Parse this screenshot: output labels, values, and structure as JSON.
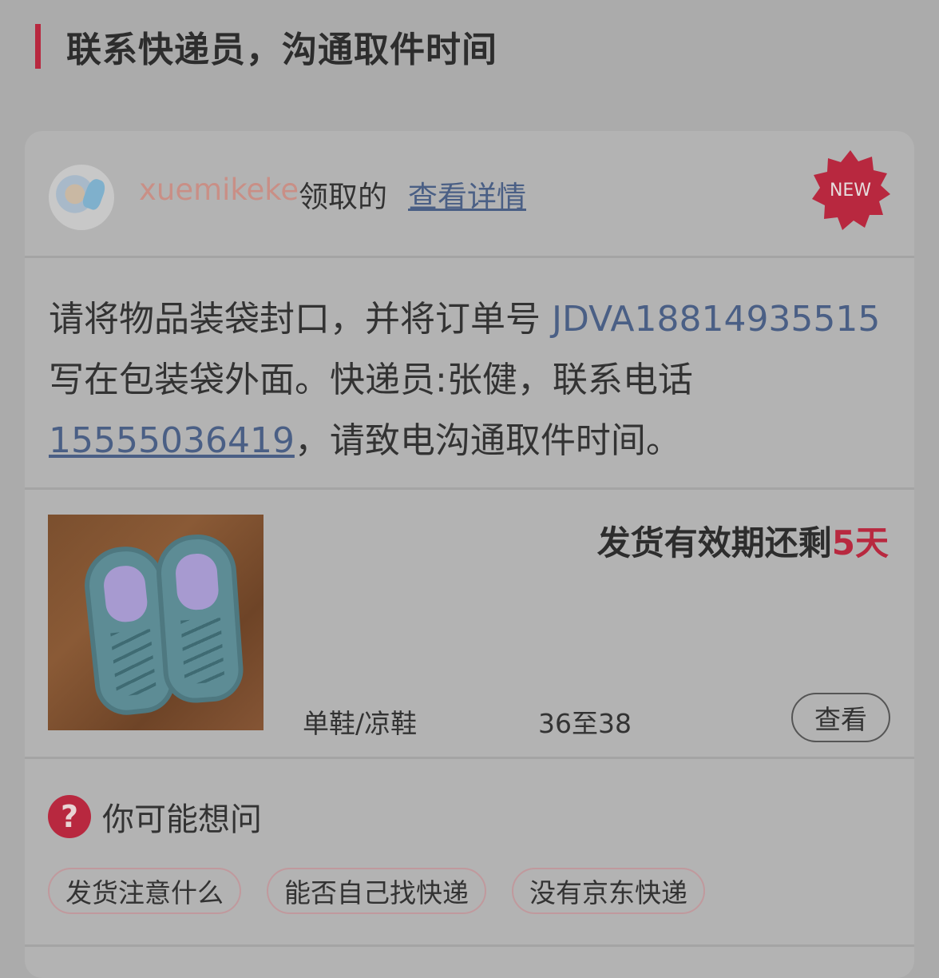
{
  "section": {
    "title": "联系快递员，沟通取件时间"
  },
  "card": {
    "user": {
      "name": "xuemikeke",
      "action": "领取的",
      "detail_link": "查看详情",
      "badge": "NEW"
    },
    "message": {
      "part1": "请将物品装袋封口，并将订单号 ",
      "order_no": "JDVA18814935515",
      "part2": " 写在包装袋外面。快递员:张健，联系电话",
      "phone": "15555036419",
      "part3": "，请致电沟通取件时间。"
    },
    "product": {
      "expire_prefix": "发货有效期还剩",
      "expire_days": "5天",
      "category": "单鞋/凉鞋",
      "size": "36至38",
      "view_label": "查看"
    },
    "faq": {
      "icon": "question-circle-icon",
      "icon_glyph": "?",
      "title": "你可能想问",
      "chips": [
        "发货注意什么",
        "能否自己找快递",
        "没有京东快递"
      ]
    }
  },
  "colors": {
    "accent": "#b8283f",
    "link": "#4a5f85",
    "username": "#c98f86"
  }
}
